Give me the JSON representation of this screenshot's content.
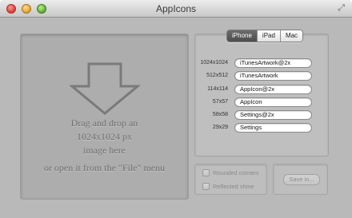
{
  "window": {
    "title": "AppIcons",
    "fullscreen_glyph": "⤢"
  },
  "dropzone": {
    "line1": "Drag and drop an",
    "line2": "1024x1024 px",
    "line3": "image here",
    "hint": "or open it from the \"File\" menu",
    "icon": "down-arrow-icon"
  },
  "tabs": [
    {
      "label": "iPhone",
      "active": true
    },
    {
      "label": "iPad",
      "active": false
    },
    {
      "label": "Mac",
      "active": false
    }
  ],
  "icons": [
    {
      "size": "1024x1024",
      "name": "iTunesArtwork@2x"
    },
    {
      "size": "512x512",
      "name": "iTunesArtwork"
    },
    {
      "size": "114x114",
      "name": "AppIcon@2x"
    },
    {
      "size": "57x57",
      "name": "AppIcon"
    },
    {
      "size": "58x58",
      "name": "Settings@2x"
    },
    {
      "size": "29x29",
      "name": "Settings"
    }
  ],
  "options": {
    "rounded_corners": {
      "label": "Rounded corners",
      "checked": false
    },
    "reflected_shine": {
      "label": "Reflected shine",
      "checked": false
    }
  },
  "save_button": "Save in..."
}
